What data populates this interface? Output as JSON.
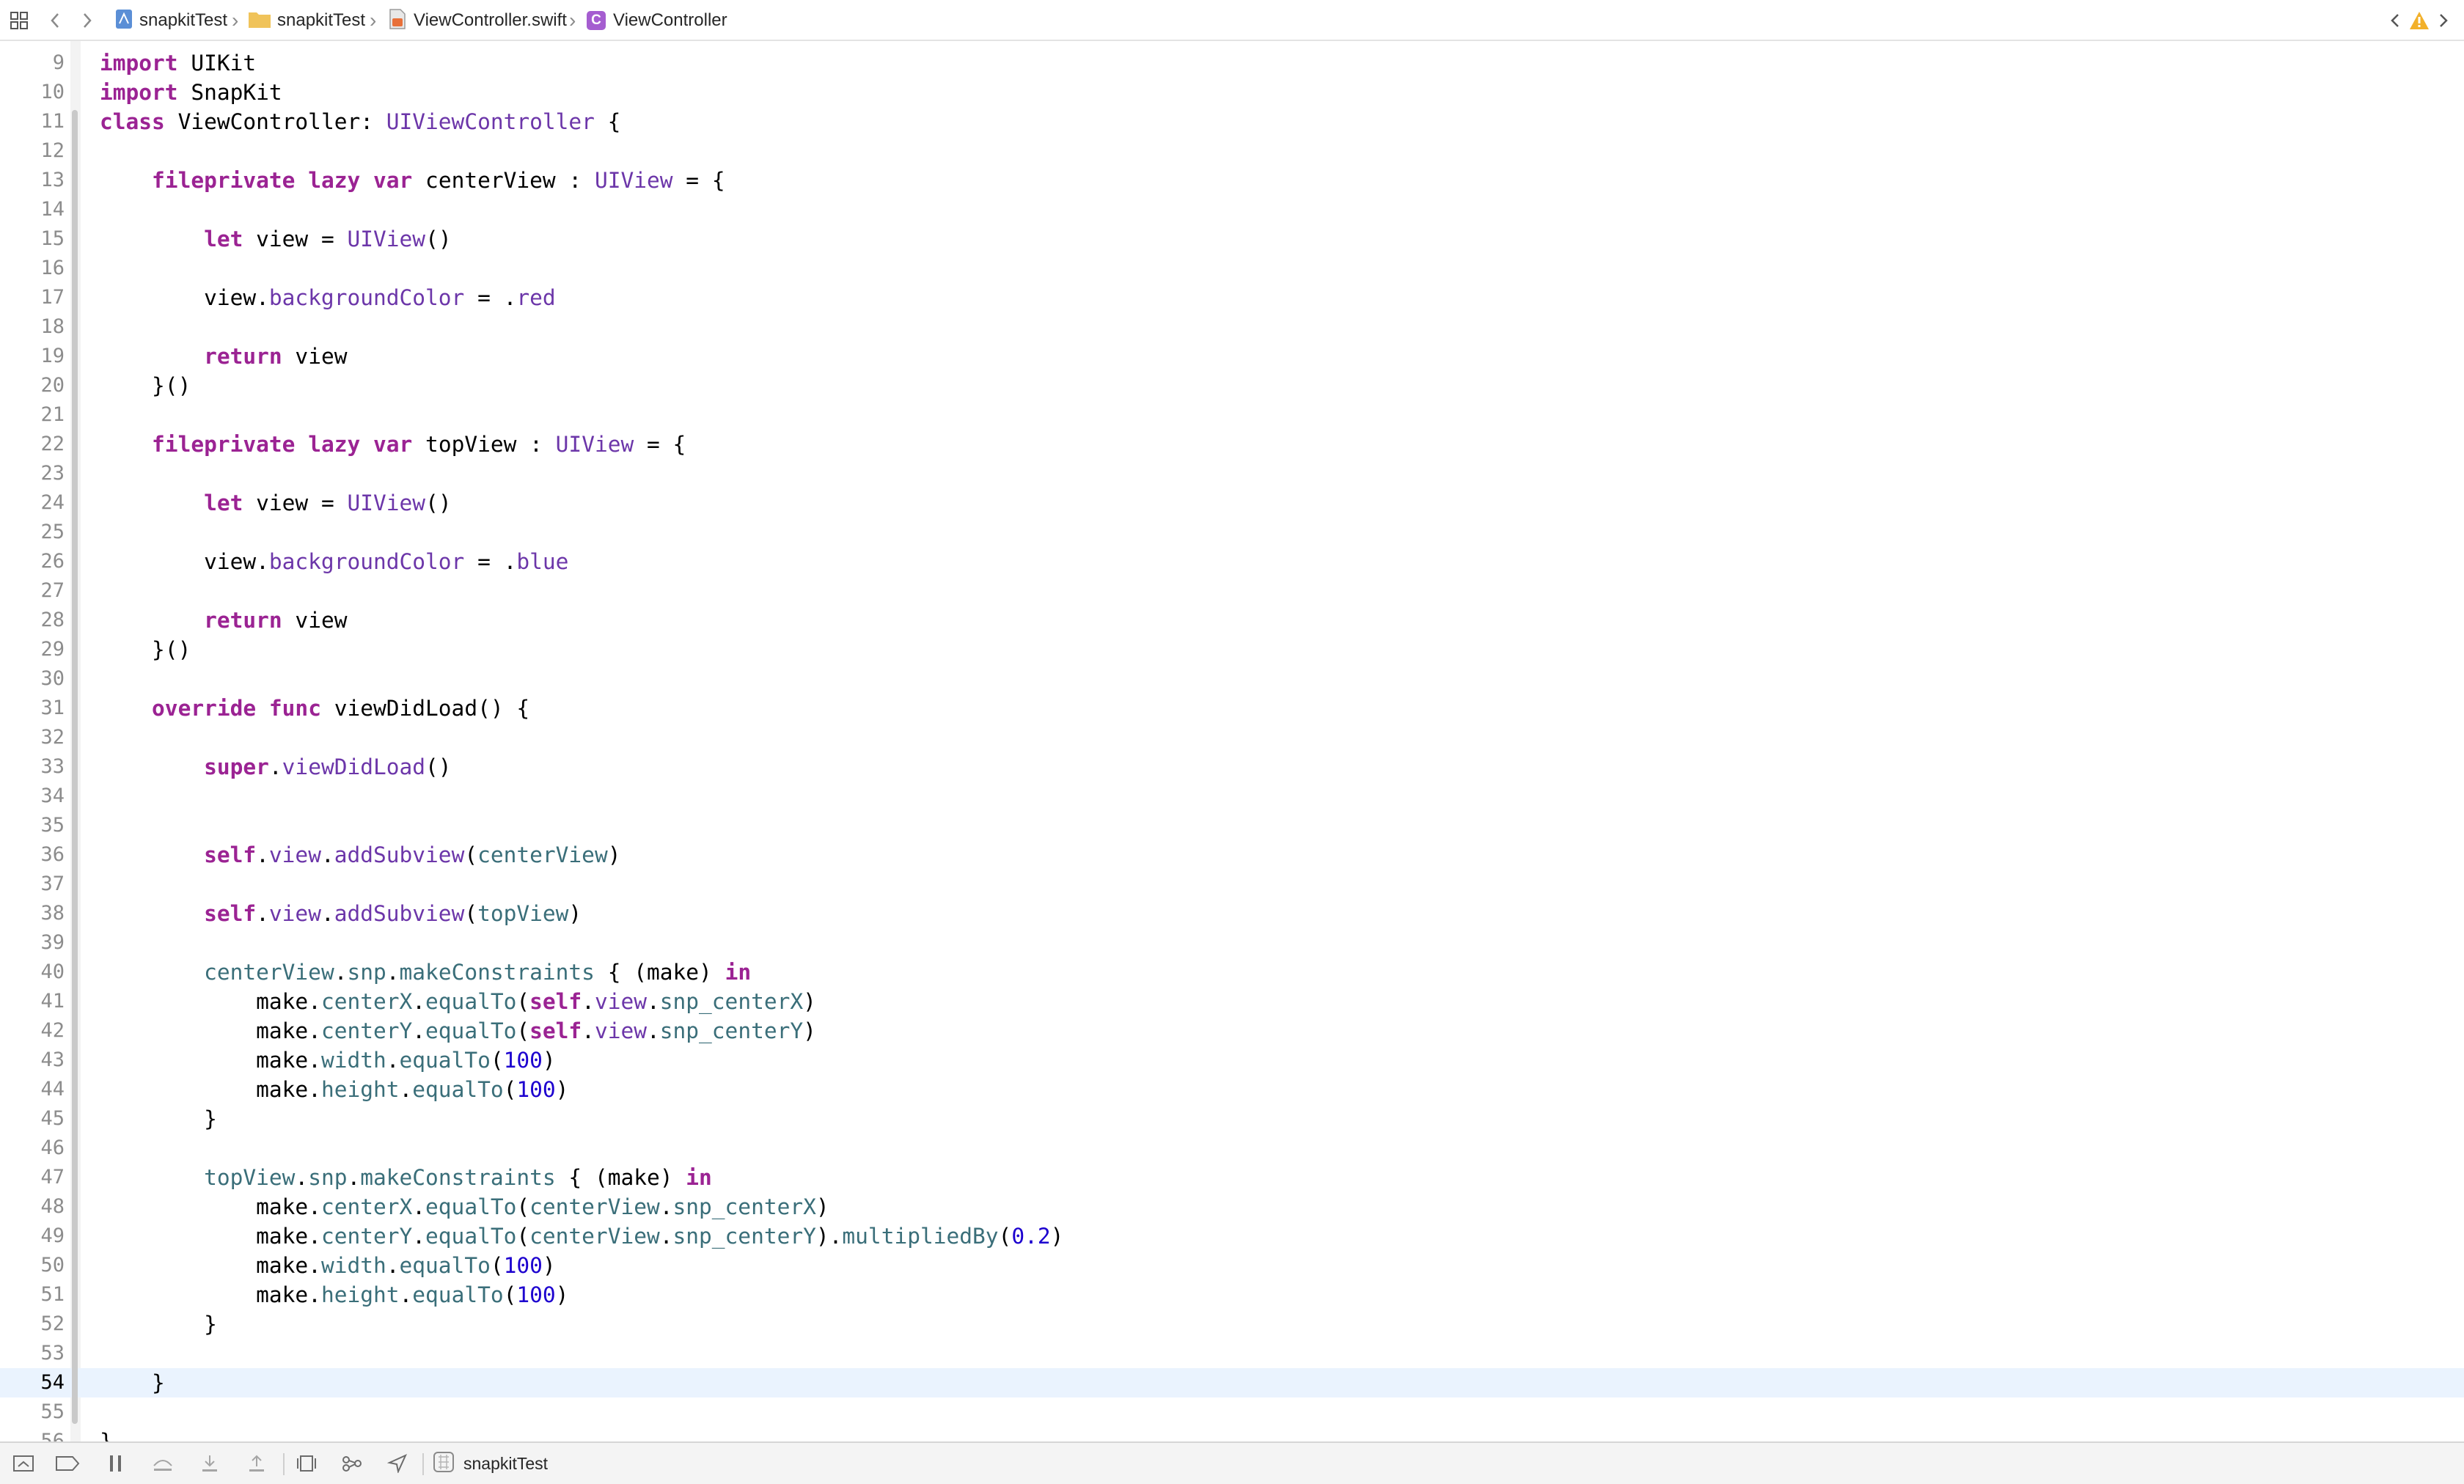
{
  "jumpbar": {
    "breadcrumbs": [
      {
        "label": "snapkitTest",
        "icon": "project-icon"
      },
      {
        "label": "snapkitTest",
        "icon": "folder-icon"
      },
      {
        "label": "ViewController.swift",
        "icon": "swift-file-icon"
      },
      {
        "label": "ViewController",
        "icon": "class-icon",
        "badge": "C"
      }
    ],
    "warning_color": "#f2b02a"
  },
  "editor": {
    "current_line": "54",
    "lines": [
      {
        "n": "9",
        "tokens": [
          {
            "t": "import",
            "c": "kw"
          },
          {
            "t": " UIKit"
          }
        ]
      },
      {
        "n": "10",
        "tokens": [
          {
            "t": "import",
            "c": "kw"
          },
          {
            "t": " SnapKit"
          }
        ]
      },
      {
        "n": "11",
        "tokens": [
          {
            "t": "class",
            "c": "kw"
          },
          {
            "t": " ViewController: "
          },
          {
            "t": "UIViewController",
            "c": "ty"
          },
          {
            "t": " {"
          }
        ]
      },
      {
        "n": "12",
        "tokens": []
      },
      {
        "n": "13",
        "tokens": [
          {
            "t": "    "
          },
          {
            "t": "fileprivate",
            "c": "kw"
          },
          {
            "t": " "
          },
          {
            "t": "lazy",
            "c": "kw"
          },
          {
            "t": " "
          },
          {
            "t": "var",
            "c": "kw"
          },
          {
            "t": " centerView : "
          },
          {
            "t": "UIView",
            "c": "ty"
          },
          {
            "t": " = {"
          }
        ]
      },
      {
        "n": "14",
        "tokens": []
      },
      {
        "n": "15",
        "tokens": [
          {
            "t": "        "
          },
          {
            "t": "let",
            "c": "kw"
          },
          {
            "t": " view = "
          },
          {
            "t": "UIView",
            "c": "ty"
          },
          {
            "t": "()"
          }
        ]
      },
      {
        "n": "16",
        "tokens": []
      },
      {
        "n": "17",
        "tokens": [
          {
            "t": "        view."
          },
          {
            "t": "backgroundColor",
            "c": "ty"
          },
          {
            "t": " = ."
          },
          {
            "t": "red",
            "c": "ty"
          }
        ]
      },
      {
        "n": "18",
        "tokens": []
      },
      {
        "n": "19",
        "tokens": [
          {
            "t": "        "
          },
          {
            "t": "return",
            "c": "kw"
          },
          {
            "t": " view"
          }
        ]
      },
      {
        "n": "20",
        "tokens": [
          {
            "t": "    }()"
          }
        ]
      },
      {
        "n": "21",
        "tokens": []
      },
      {
        "n": "22",
        "tokens": [
          {
            "t": "    "
          },
          {
            "t": "fileprivate",
            "c": "kw"
          },
          {
            "t": " "
          },
          {
            "t": "lazy",
            "c": "kw"
          },
          {
            "t": " "
          },
          {
            "t": "var",
            "c": "kw"
          },
          {
            "t": " topView : "
          },
          {
            "t": "UIView",
            "c": "ty"
          },
          {
            "t": " = {"
          }
        ]
      },
      {
        "n": "23",
        "tokens": []
      },
      {
        "n": "24",
        "tokens": [
          {
            "t": "        "
          },
          {
            "t": "let",
            "c": "kw"
          },
          {
            "t": " view = "
          },
          {
            "t": "UIView",
            "c": "ty"
          },
          {
            "t": "()"
          }
        ]
      },
      {
        "n": "25",
        "tokens": []
      },
      {
        "n": "26",
        "tokens": [
          {
            "t": "        view."
          },
          {
            "t": "backgroundColor",
            "c": "ty"
          },
          {
            "t": " = ."
          },
          {
            "t": "blue",
            "c": "ty"
          }
        ]
      },
      {
        "n": "27",
        "tokens": []
      },
      {
        "n": "28",
        "tokens": [
          {
            "t": "        "
          },
          {
            "t": "return",
            "c": "kw"
          },
          {
            "t": " view"
          }
        ]
      },
      {
        "n": "29",
        "tokens": [
          {
            "t": "    }()"
          }
        ]
      },
      {
        "n": "30",
        "tokens": []
      },
      {
        "n": "31",
        "tokens": [
          {
            "t": "    "
          },
          {
            "t": "override",
            "c": "kw"
          },
          {
            "t": " "
          },
          {
            "t": "func",
            "c": "kw"
          },
          {
            "t": " viewDidLoad() {"
          }
        ]
      },
      {
        "n": "32",
        "tokens": []
      },
      {
        "n": "33",
        "tokens": [
          {
            "t": "        "
          },
          {
            "t": "super",
            "c": "kw"
          },
          {
            "t": "."
          },
          {
            "t": "viewDidLoad",
            "c": "fn"
          },
          {
            "t": "()"
          }
        ]
      },
      {
        "n": "34",
        "tokens": []
      },
      {
        "n": "35",
        "tokens": []
      },
      {
        "n": "36",
        "tokens": [
          {
            "t": "        "
          },
          {
            "t": "self",
            "c": "kw"
          },
          {
            "t": "."
          },
          {
            "t": "view",
            "c": "ty"
          },
          {
            "t": "."
          },
          {
            "t": "addSubview",
            "c": "fn"
          },
          {
            "t": "("
          },
          {
            "t": "centerView",
            "c": "pr"
          },
          {
            "t": ")"
          }
        ]
      },
      {
        "n": "37",
        "tokens": []
      },
      {
        "n": "38",
        "tokens": [
          {
            "t": "        "
          },
          {
            "t": "self",
            "c": "kw"
          },
          {
            "t": "."
          },
          {
            "t": "view",
            "c": "ty"
          },
          {
            "t": "."
          },
          {
            "t": "addSubview",
            "c": "fn"
          },
          {
            "t": "("
          },
          {
            "t": "topView",
            "c": "pr"
          },
          {
            "t": ")"
          }
        ]
      },
      {
        "n": "39",
        "tokens": []
      },
      {
        "n": "40",
        "tokens": [
          {
            "t": "        "
          },
          {
            "t": "centerView",
            "c": "pr"
          },
          {
            "t": "."
          },
          {
            "t": "snp",
            "c": "pr"
          },
          {
            "t": "."
          },
          {
            "t": "makeConstraints",
            "c": "pr"
          },
          {
            "t": " { (make) "
          },
          {
            "t": "in",
            "c": "kw"
          }
        ]
      },
      {
        "n": "41",
        "tokens": [
          {
            "t": "            make."
          },
          {
            "t": "centerX",
            "c": "pr"
          },
          {
            "t": "."
          },
          {
            "t": "equalTo",
            "c": "pr"
          },
          {
            "t": "("
          },
          {
            "t": "self",
            "c": "kw"
          },
          {
            "t": "."
          },
          {
            "t": "view",
            "c": "ty"
          },
          {
            "t": "."
          },
          {
            "t": "snp_centerX",
            "c": "pr"
          },
          {
            "t": ")"
          }
        ]
      },
      {
        "n": "42",
        "tokens": [
          {
            "t": "            make."
          },
          {
            "t": "centerY",
            "c": "pr"
          },
          {
            "t": "."
          },
          {
            "t": "equalTo",
            "c": "pr"
          },
          {
            "t": "("
          },
          {
            "t": "self",
            "c": "kw"
          },
          {
            "t": "."
          },
          {
            "t": "view",
            "c": "ty"
          },
          {
            "t": "."
          },
          {
            "t": "snp_centerY",
            "c": "pr"
          },
          {
            "t": ")"
          }
        ]
      },
      {
        "n": "43",
        "tokens": [
          {
            "t": "            make."
          },
          {
            "t": "width",
            "c": "pr"
          },
          {
            "t": "."
          },
          {
            "t": "equalTo",
            "c": "pr"
          },
          {
            "t": "("
          },
          {
            "t": "100",
            "c": "num"
          },
          {
            "t": ")"
          }
        ]
      },
      {
        "n": "44",
        "tokens": [
          {
            "t": "            make."
          },
          {
            "t": "height",
            "c": "pr"
          },
          {
            "t": "."
          },
          {
            "t": "equalTo",
            "c": "pr"
          },
          {
            "t": "("
          },
          {
            "t": "100",
            "c": "num"
          },
          {
            "t": ")"
          }
        ]
      },
      {
        "n": "45",
        "tokens": [
          {
            "t": "        }"
          }
        ]
      },
      {
        "n": "46",
        "tokens": []
      },
      {
        "n": "47",
        "tokens": [
          {
            "t": "        "
          },
          {
            "t": "topView",
            "c": "pr"
          },
          {
            "t": "."
          },
          {
            "t": "snp",
            "c": "pr"
          },
          {
            "t": "."
          },
          {
            "t": "makeConstraints",
            "c": "pr"
          },
          {
            "t": " { (make) "
          },
          {
            "t": "in",
            "c": "kw"
          }
        ]
      },
      {
        "n": "48",
        "tokens": [
          {
            "t": "            make."
          },
          {
            "t": "centerX",
            "c": "pr"
          },
          {
            "t": "."
          },
          {
            "t": "equalTo",
            "c": "pr"
          },
          {
            "t": "("
          },
          {
            "t": "centerView",
            "c": "pr"
          },
          {
            "t": "."
          },
          {
            "t": "snp_centerX",
            "c": "pr"
          },
          {
            "t": ")"
          }
        ]
      },
      {
        "n": "49",
        "tokens": [
          {
            "t": "            make."
          },
          {
            "t": "centerY",
            "c": "pr"
          },
          {
            "t": "."
          },
          {
            "t": "equalTo",
            "c": "pr"
          },
          {
            "t": "("
          },
          {
            "t": "centerView",
            "c": "pr"
          },
          {
            "t": "."
          },
          {
            "t": "snp_centerY",
            "c": "pr"
          },
          {
            "t": ")."
          },
          {
            "t": "multipliedBy",
            "c": "pr"
          },
          {
            "t": "("
          },
          {
            "t": "0.2",
            "c": "num"
          },
          {
            "t": ")"
          }
        ]
      },
      {
        "n": "50",
        "tokens": [
          {
            "t": "            make."
          },
          {
            "t": "width",
            "c": "pr"
          },
          {
            "t": "."
          },
          {
            "t": "equalTo",
            "c": "pr"
          },
          {
            "t": "("
          },
          {
            "t": "100",
            "c": "num"
          },
          {
            "t": ")"
          }
        ]
      },
      {
        "n": "51",
        "tokens": [
          {
            "t": "            make."
          },
          {
            "t": "height",
            "c": "pr"
          },
          {
            "t": "."
          },
          {
            "t": "equalTo",
            "c": "pr"
          },
          {
            "t": "("
          },
          {
            "t": "100",
            "c": "num"
          },
          {
            "t": ")"
          }
        ]
      },
      {
        "n": "52",
        "tokens": [
          {
            "t": "        }"
          }
        ]
      },
      {
        "n": "53",
        "tokens": []
      },
      {
        "n": "54",
        "tokens": [
          {
            "t": "    }"
          }
        ]
      },
      {
        "n": "55",
        "tokens": []
      },
      {
        "n": "56",
        "tokens": [
          {
            "t": "}"
          }
        ]
      }
    ]
  },
  "debugbar": {
    "icons": [
      "hide-debug-area-icon",
      "breakpoints-toggle-icon",
      "pause-icon",
      "step-over-icon",
      "step-into-icon",
      "step-out-icon",
      "view-hierarchy-icon",
      "memory-graph-icon",
      "simulate-location-icon"
    ],
    "scheme_label": "snapkitTest"
  }
}
